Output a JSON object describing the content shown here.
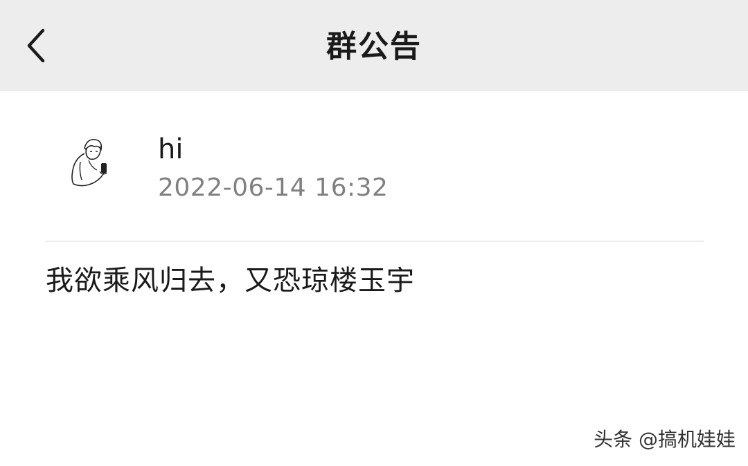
{
  "header": {
    "title": "群公告",
    "back_icon": "chevron-left-icon"
  },
  "announcement": {
    "author_name": "hi",
    "timestamp": "2022-06-14 16:32",
    "content": "我欲乘风归去，又恐琼楼玉宇"
  },
  "watermark": {
    "text": "头条 @搞机娃娃"
  },
  "colors": {
    "header_bg": "#ededed",
    "page_bg": "#ffffff",
    "text_primary": "#1a1a1a",
    "text_secondary": "#808080",
    "divider": "#ececec"
  }
}
